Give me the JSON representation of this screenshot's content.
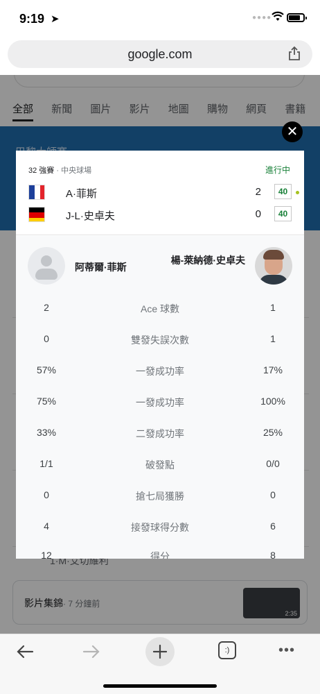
{
  "status": {
    "time": "9:19"
  },
  "browser": {
    "url": "google.com"
  },
  "background": {
    "tabs": [
      "全部",
      "新聞",
      "圖片",
      "影片",
      "地圖",
      "購物",
      "網頁",
      "書籍"
    ],
    "banner_title": "巴黎大師賽",
    "bottom_row": "1·M·艾切維利",
    "video_label": "影片集錦",
    "video_age": "· 7 分鐘前",
    "video_duration": "2:35"
  },
  "match": {
    "round": "32 強賽",
    "venue": "· 中央球場",
    "status": "進行中",
    "teams": [
      {
        "name": "A·菲斯",
        "sets": "2",
        "points": "40",
        "serving": true
      },
      {
        "name": "J-L·史卓夫",
        "sets": "0",
        "points": "40",
        "serving": false
      }
    ]
  },
  "players": {
    "left": "阿蒂爾·菲斯",
    "right": "楊-萊納德·史卓夫"
  },
  "stats": [
    {
      "label": "Ace 球數",
      "left": "2",
      "right": "1"
    },
    {
      "label": "雙發失誤次數",
      "left": "0",
      "right": "1"
    },
    {
      "label": "一發成功率",
      "left": "57%",
      "right": "17%"
    },
    {
      "label": "一發成功率",
      "left": "75%",
      "right": "100%"
    },
    {
      "label": "二發成功率",
      "left": "33%",
      "right": "25%"
    },
    {
      "label": "破發點",
      "left": "1/1",
      "right": "0/0"
    },
    {
      "label": "搶七局獲勝",
      "left": "0",
      "right": "0"
    },
    {
      "label": "接發球得分數",
      "left": "4",
      "right": "6"
    },
    {
      "label": "得分",
      "left": "12",
      "right": "8"
    }
  ],
  "toolbar": {
    "tabs_label": ":)"
  }
}
